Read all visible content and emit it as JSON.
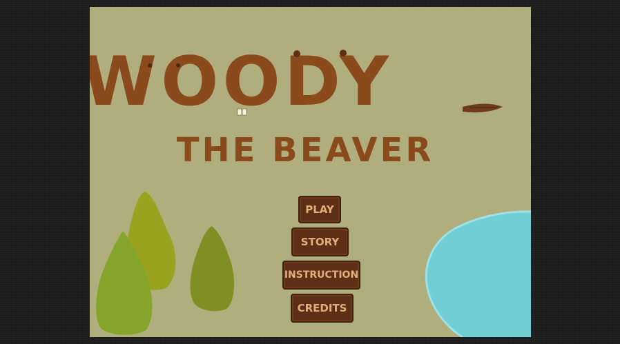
{
  "title": {
    "main": "WOODY",
    "subtitle": "THE BEAVER"
  },
  "menu": {
    "play": "PLAY",
    "story": "STORY",
    "instruction": "INSTRUCTION",
    "credits": "CREDITS"
  },
  "colors": {
    "background": "#b0ae7d",
    "title_brown": "#8a4a1b",
    "button_fill": "#5d2f17",
    "button_text": "#e3ad7a",
    "pond": "#70ced4",
    "tree_dark": "#85a52a",
    "tree_light": "#9ba21f"
  }
}
